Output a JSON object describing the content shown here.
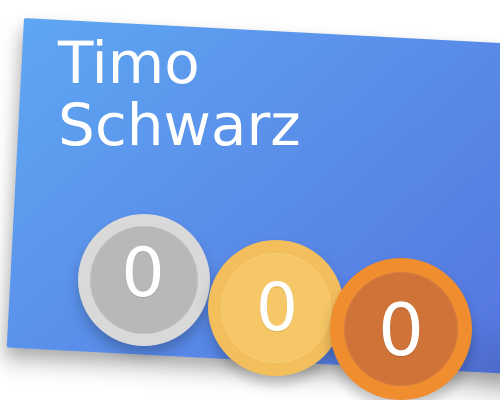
{
  "card": {
    "first_name": "Timo",
    "last_name": "Schwarz",
    "gradient_start": "#5ea7f2",
    "gradient_end": "#5474df"
  },
  "medals": [
    {
      "name": "silver",
      "count": "0",
      "outer_color": "#d9d9d9",
      "inner_color": "#b8b8b8"
    },
    {
      "name": "gold",
      "count": "0",
      "outer_color": "#f3be5c",
      "inner_color": "#f6c766"
    },
    {
      "name": "bronze",
      "count": "0",
      "outer_color": "#f08d2e",
      "inner_color": "#cf7338"
    }
  ]
}
